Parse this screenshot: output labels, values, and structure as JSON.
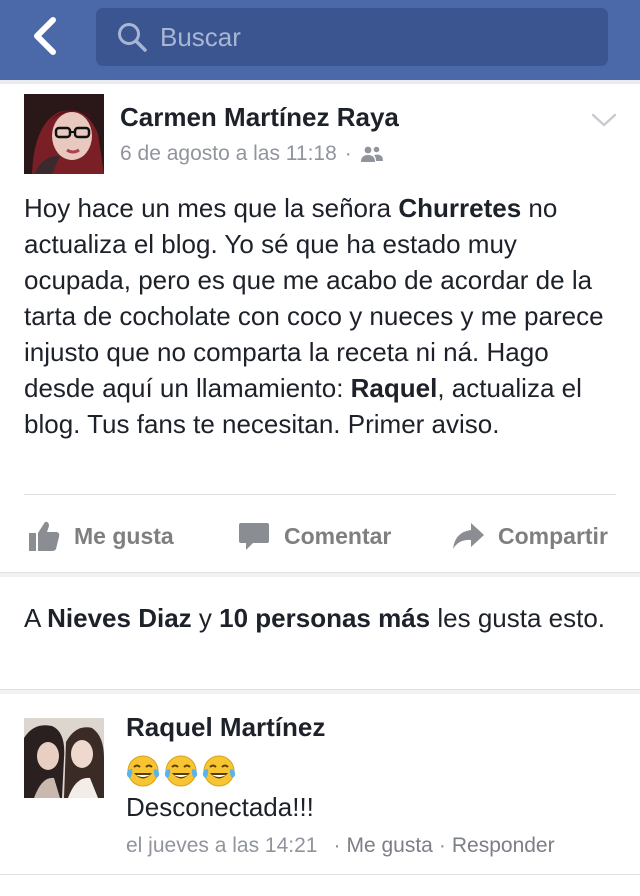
{
  "topbar": {
    "back_icon": "chevron-left-icon",
    "search_placeholder": "Buscar",
    "search_icon": "search-icon",
    "bg_color": "#4b69a8"
  },
  "post": {
    "author": "Carmen Martínez Raya",
    "timestamp": "6 de agosto a las 11:18",
    "separator": "·",
    "audience_icon": "friends-icon",
    "text_parts": [
      "Hoy hace un mes que la señora ",
      "Churretes",
      " no actualiza el blog. Yo sé que ha estado muy ocupada, pero es que me acabo de acordar de la tarta de cocholate con coco y nueces y me parece injusto que no comparta la receta ni ná. Hago desde aquí un llamamiento: ",
      "Raquel",
      ", actualiza el blog. Tus fans te necesitan. Primer aviso."
    ]
  },
  "actions": {
    "like": "Me gusta",
    "comment": "Comentar",
    "share": "Compartir"
  },
  "likes_summary": {
    "prefix": "A ",
    "name": "Nieves Diaz",
    "middle": " y ",
    "others": "10 personas más",
    "suffix": " les gusta esto."
  },
  "comment": {
    "author": "Raquel Martínez",
    "emojis": [
      "face-with-tears-of-joy-icon",
      "face-with-tears-of-joy-icon",
      "face-with-tears-of-joy-icon"
    ],
    "text": "Desconectada!!!",
    "timestamp": "el jueves a las 14:21",
    "dot1": "·",
    "like": "Me gusta",
    "dot2": "·",
    "reply": "Responder"
  }
}
